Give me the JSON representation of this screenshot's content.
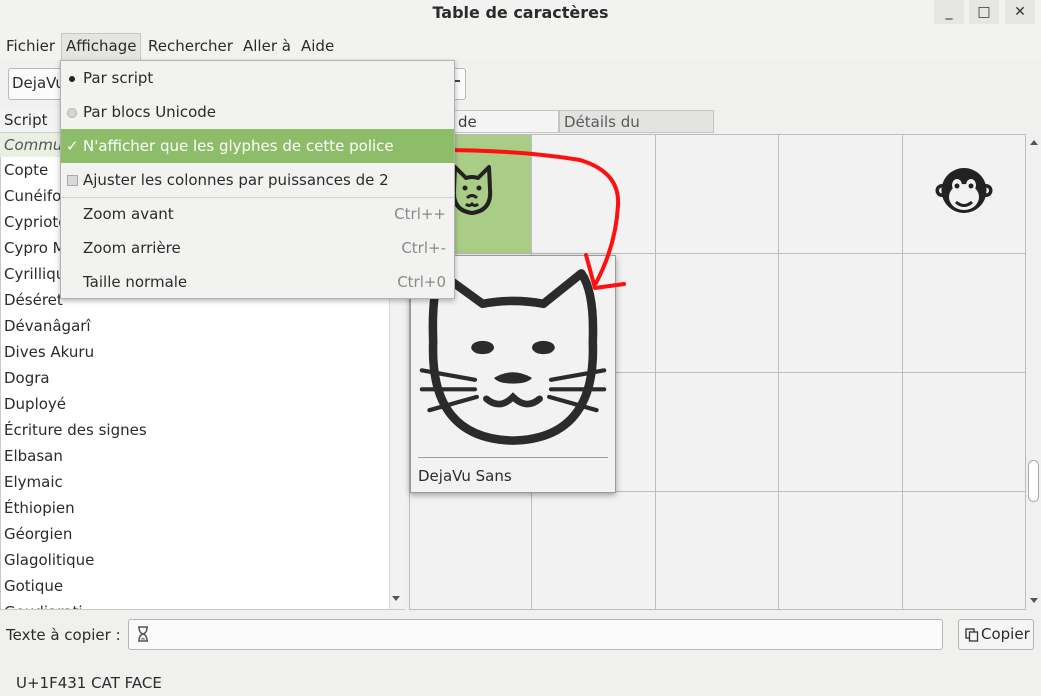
{
  "window": {
    "title": "Table de caractères",
    "controls": {
      "minimize": "_",
      "maximize": "□",
      "close": "✕"
    }
  },
  "menubar": [
    "Fichier",
    "Affichage",
    "Rechercher",
    "Aller à",
    "Aide"
  ],
  "toolbar": {
    "font_combo": "DejaVu"
  },
  "view_menu": {
    "by_script": "Par script",
    "by_unicode_blocks": "Par blocs Unicode",
    "only_font_glyphs": "N'afficher que les glyphes de cette police",
    "power_of_two_columns": "Ajuster les colonnes par puissances de 2",
    "zoom_in": {
      "label": "Zoom avant",
      "shortcut": "Ctrl++"
    },
    "zoom_out": {
      "label": "Zoom arrière",
      "shortcut": "Ctrl+-"
    },
    "normal_size": {
      "label": "Taille normale",
      "shortcut": "Ctrl+0"
    }
  },
  "script_list": {
    "header": "Script",
    "items": [
      "Commu",
      "Copte",
      "Cunéifo",
      "Cypriote",
      "Cypro M",
      "Cyrilliqu",
      "Déséret",
      "Dévanâgarî",
      "Dives Akuru",
      "Dogra",
      "Duployé",
      "Écriture des signes",
      "Elbasan",
      "Elymaic",
      "Éthiopien",
      "Géorgien",
      "Glagolitique",
      "Gotique",
      "Goudjarati"
    ]
  },
  "tabs": {
    "table": "de caractères",
    "details": "Détails du caractère"
  },
  "popup": {
    "font_name": "DejaVu Sans"
  },
  "glyphs": {
    "selected": "cat-face",
    "monkey": "monkey-face"
  },
  "copy_area": {
    "label": "Texte à copier :",
    "button": "Copier"
  },
  "status": "U+1F431 CAT FACE",
  "colors": {
    "selection": "#a9cc86",
    "menu_highlight": "#8ebd69",
    "arrow": "#ff1010"
  }
}
